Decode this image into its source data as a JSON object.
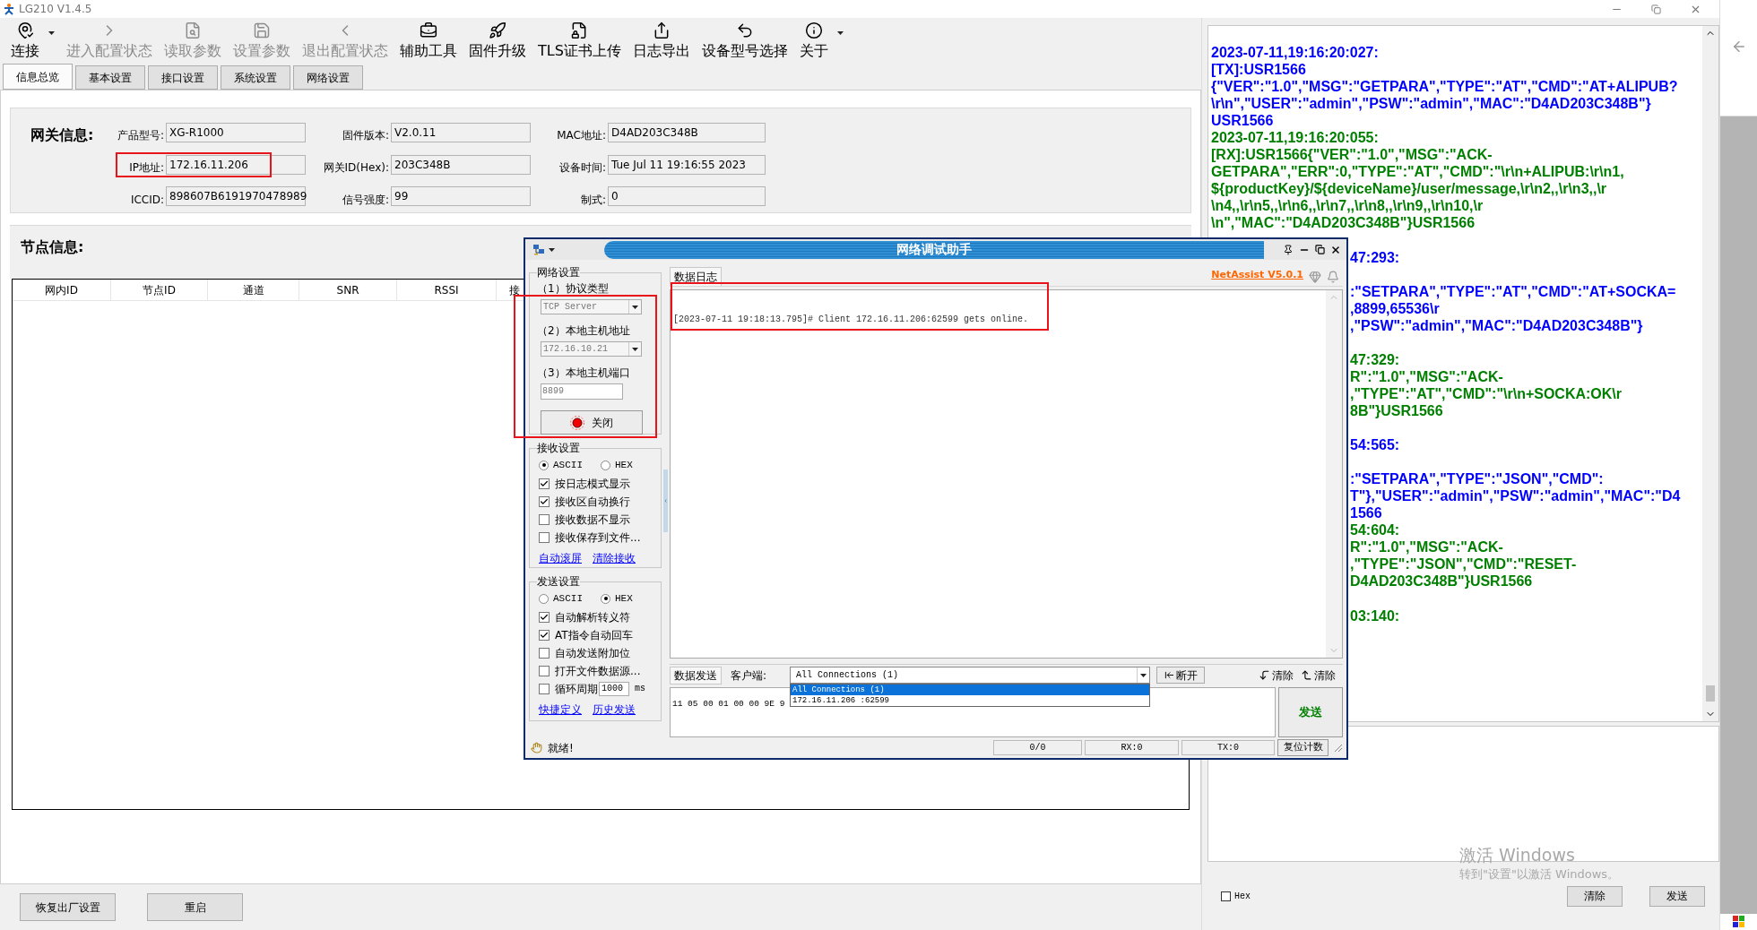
{
  "window": {
    "title": "LG210 V1.4.5"
  },
  "toolbar": [
    {
      "label": "连接",
      "disabled": false,
      "dropdown": true
    },
    {
      "label": "进入配置状态",
      "disabled": true,
      "dropdown": false
    },
    {
      "label": "读取参数",
      "disabled": true,
      "dropdown": false
    },
    {
      "label": "设置参数",
      "disabled": true,
      "dropdown": false
    },
    {
      "label": "退出配置状态",
      "disabled": true,
      "dropdown": false
    },
    {
      "label": "辅助工具",
      "disabled": false,
      "dropdown": false
    },
    {
      "label": "固件升级",
      "disabled": false,
      "dropdown": false
    },
    {
      "label": "TLS证书上传",
      "disabled": false,
      "dropdown": false
    },
    {
      "label": "日志导出",
      "disabled": false,
      "dropdown": false
    },
    {
      "label": "设备型号选择",
      "disabled": false,
      "dropdown": false
    },
    {
      "label": "关于",
      "disabled": false,
      "dropdown": true
    }
  ],
  "tabs": [
    {
      "label": "信息总览",
      "selected": true
    },
    {
      "label": "基本设置",
      "selected": false
    },
    {
      "label": "接口设置",
      "selected": false
    },
    {
      "label": "系统设置",
      "selected": false
    },
    {
      "label": "网络设置",
      "selected": false
    }
  ],
  "gateway": {
    "title": "网关信息:",
    "fields": [
      {
        "label": "产品型号:",
        "value": "XG-R1000",
        "highlighted": false
      },
      {
        "label": "固件版本:",
        "value": "V2.0.11",
        "highlighted": false
      },
      {
        "label": "MAC地址:",
        "value": "D4AD203C348B",
        "highlighted": false
      },
      {
        "label": "IP地址:",
        "value": "172.16.11.206",
        "highlighted": true
      },
      {
        "label": "网关ID(Hex):",
        "value": "203C348B",
        "highlighted": false
      },
      {
        "label": "设备时间:",
        "value": "Tue Jul 11 19:16:55 2023",
        "highlighted": false
      },
      {
        "label": "ICCID:",
        "value": "898607B6191970478989",
        "highlighted": false
      },
      {
        "label": "信号强度:",
        "value": "99",
        "highlighted": false
      },
      {
        "label": "制式:",
        "value": "0",
        "highlighted": false
      }
    ]
  },
  "nodes": {
    "title": "节点信息:",
    "columns": [
      "网内ID",
      "节点ID",
      "通道",
      "SNR",
      "RSSI",
      "接"
    ]
  },
  "footer_buttons": [
    "恢复出厂设置",
    "重启"
  ],
  "log": {
    "lines": [
      {
        "kind": "line",
        "color": "#0000ff",
        "text": "2023-07-11,19:16:20:027:"
      },
      {
        "kind": "line",
        "color": "#0000ff",
        "text": "[TX]:USR1566"
      },
      {
        "kind": "line",
        "color": "#0000ff",
        "text": "{\"VER\":\"1.0\",\"MSG\":\"GETPARA\",\"TYPE\":\"AT\",\"CMD\":\"AT+ALIPUB?"
      },
      {
        "kind": "line",
        "color": "#0000ff",
        "text": "\\r\\n\",\"USER\":\"admin\",\"PSW\":\"admin\",\"MAC\":\"D4AD203C348B\"}"
      },
      {
        "kind": "line",
        "color": "#0000ff",
        "text": "USR1566"
      },
      {
        "kind": "line",
        "color": "#008000",
        "text": "2023-07-11,19:16:20:055:"
      },
      {
        "kind": "line",
        "color": "#008000",
        "text": "[RX]:USR1566{\"VER\":\"1.0\",\"MSG\":\"ACK-"
      },
      {
        "kind": "line",
        "color": "#008000",
        "text": "GETPARA\",\"ERR\":0,\"TYPE\":\"AT\",\"CMD\":\"\\r\\n+ALIPUB:\\r\\n1,"
      },
      {
        "kind": "line",
        "color": "#008000",
        "text": "${productKey}/${deviceName}/user/message,\\r\\n2,,\\r\\n3,,\\r"
      },
      {
        "kind": "line",
        "color": "#008000",
        "text": "\\n4,,\\r\\n5,,\\r\\n6,,\\r\\n7,,\\r\\n8,,\\r\\n9,,\\r\\n10,\\r"
      },
      {
        "kind": "line",
        "color": "#008000",
        "text": "\\n\",\"MAC\":\"D4AD203C348B\"}USR1566"
      },
      {
        "kind": "gap"
      },
      {
        "kind": "tail",
        "color": "#0000ff",
        "text": "47:293:"
      },
      {
        "kind": "gap"
      },
      {
        "kind": "tail",
        "color": "#0000ff",
        "text": ":\"SETPARA\",\"TYPE\":\"AT\",\"CMD\":\"AT+SOCKA="
      },
      {
        "kind": "tail",
        "color": "#0000ff",
        "text": ",8899,65536\\r"
      },
      {
        "kind": "tail",
        "color": "#0000ff",
        "text": ",\"PSW\":\"admin\",\"MAC\":\"D4AD203C348B\"}"
      },
      {
        "kind": "gap"
      },
      {
        "kind": "tail",
        "color": "#008000",
        "text": "47:329:"
      },
      {
        "kind": "tail",
        "color": "#008000",
        "text": "R\":\"1.0\",\"MSG\":\"ACK-"
      },
      {
        "kind": "tail",
        "color": "#008000",
        "text": ",\"TYPE\":\"AT\",\"CMD\":\"\\r\\n+SOCKA:OK\\r"
      },
      {
        "kind": "tail",
        "color": "#008000",
        "text": "8B\"}USR1566"
      },
      {
        "kind": "gap"
      },
      {
        "kind": "tail",
        "color": "#0000ff",
        "text": "54:565:"
      },
      {
        "kind": "gap"
      },
      {
        "kind": "tail",
        "color": "#0000ff",
        "text": ":\"SETPARA\",\"TYPE\":\"JSON\",\"CMD\":"
      },
      {
        "kind": "tail",
        "color": "#0000ff",
        "text": "T\"},\"USER\":\"admin\",\"PSW\":\"admin\",\"MAC\":\"D4"
      },
      {
        "kind": "tail",
        "color": "#0000ff",
        "text": "1566"
      },
      {
        "kind": "tail",
        "color": "#008000",
        "text": "54:604:"
      },
      {
        "kind": "tail",
        "color": "#008000",
        "text": "R\":\"1.0\",\"MSG\":\"ACK-"
      },
      {
        "kind": "tail",
        "color": "#008000",
        "text": ",\"TYPE\":\"JSON\",\"CMD\":\"RESET-"
      },
      {
        "kind": "tail",
        "color": "#008000",
        "text": "D4AD203C348B\"}USR1566"
      },
      {
        "kind": "gap"
      },
      {
        "kind": "tail",
        "color": "#008000",
        "text": "03:140:"
      }
    ]
  },
  "log_footer": {
    "hex": {
      "label": "Hex",
      "checked": false
    },
    "buttons": [
      "清除",
      "发送"
    ]
  },
  "windows_activation": {
    "title": "激活 Windows",
    "hint": "转到\"设置\"以激活 Windows。"
  },
  "netassist": {
    "title": "网络调试助手",
    "brand": "NetAssist V5.0.1",
    "network": {
      "title": "网络设置",
      "highlighted": true,
      "disabled": true,
      "protocol_label": "（1）协议类型",
      "protocol": "TCP Server",
      "host_label": "（2）本地主机地址",
      "host": "172.16.10.21",
      "port_label": "（3）本地主机端口",
      "port": "8899",
      "button": "关闭"
    },
    "receive": {
      "title": "接收设置",
      "modes": [
        {
          "label": "ASCII",
          "selected": true
        },
        {
          "label": "HEX",
          "selected": false
        }
      ],
      "options": [
        {
          "kind": "check",
          "label": "按日志模式显示",
          "checked": true
        },
        {
          "kind": "check",
          "label": "接收区自动换行",
          "checked": true
        },
        {
          "kind": "check",
          "label": "接收数据不显示",
          "checked": false
        },
        {
          "kind": "check",
          "label": "接收保存到文件...",
          "checked": false
        }
      ],
      "links": [
        "自动滚屏",
        "清除接收"
      ]
    },
    "send_settings": {
      "title": "发送设置",
      "modes": [
        {
          "label": "ASCII",
          "selected": false
        },
        {
          "label": "HEX",
          "selected": true
        }
      ],
      "options": [
        {
          "kind": "check",
          "label": "自动解析转义符",
          "checked": true
        },
        {
          "kind": "check",
          "label": "AT指令自动回车",
          "checked": true
        },
        {
          "kind": "check",
          "label": "自动发送附加位",
          "checked": false
        },
        {
          "kind": "check",
          "label": "打开文件数据源...",
          "checked": false
        },
        {
          "kind": "period",
          "label": "循环周期",
          "checked": false,
          "value": "1000",
          "unit": "ms"
        }
      ],
      "links": [
        "快捷定义",
        "历史发送"
      ]
    },
    "data_log": {
      "tab": "数据日志",
      "lines": [
        {
          "text": "[2023-07-11 19:18:13.795]# Client 172.16.11.206:62599 gets online.",
          "highlighted": true
        }
      ]
    },
    "send": {
      "tab": "数据发送",
      "client_label": "客户端:",
      "client": "All Connections (1)",
      "options": [
        {
          "label": "All Connections (1)",
          "selected": true
        },
        {
          "label": "172.16.11.206 :62599",
          "selected": false
        }
      ],
      "disconnect": "断开",
      "clear_buttons": [
        "清除",
        "清除"
      ],
      "input": "11 05 00 01 00 00 9E 9",
      "send": "发送"
    },
    "status": {
      "text": "就绪!",
      "counter": "0/0",
      "rx": "RX:0",
      "tx": "TX:0",
      "reset": "复位计数"
    }
  }
}
